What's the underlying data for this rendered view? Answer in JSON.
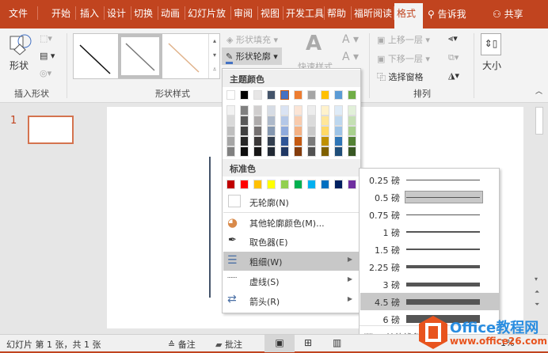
{
  "tabs": [
    "文件",
    "开始",
    "插入",
    "设计",
    "切换",
    "动画",
    "幻灯片放",
    "审阅",
    "视图",
    "开发工具",
    "帮助",
    "福昕阅读",
    "格式"
  ],
  "tell_me": "告诉我",
  "share": "共享",
  "ribbon": {
    "shapes_label": "形状",
    "insert_shapes_group": "插入形状",
    "shape_styles_group": "形状样式",
    "shape_fill": "形状填充",
    "shape_outline": "形状轮廓",
    "quick_styles": "快速样式",
    "bring_forward": "上移一层",
    "send_backward": "下移一层",
    "selection_pane": "选择窗格",
    "arrange_group": "排列",
    "size": "大小"
  },
  "menu": {
    "theme_colors": "主题颜色",
    "standard_colors": "标准色",
    "no_outline": "无轮廓(N)",
    "more_colors": "其他轮廓颜色(M)...",
    "eyedropper": "取色器(E)",
    "weight": "粗细(W)",
    "dashes": "虚线(S)",
    "arrows": "箭头(R)"
  },
  "theme_colors": [
    "#ffffff",
    "#000000",
    "#e7e6e6",
    "#44546a",
    "#4472c4",
    "#ed7d31",
    "#a5a5a5",
    "#ffc000",
    "#5b9bd5",
    "#70ad47"
  ],
  "theme_shades": [
    [
      "#f2f2f2",
      "#d9d9d9",
      "#bfbfbf",
      "#a6a6a6",
      "#808080"
    ],
    [
      "#808080",
      "#595959",
      "#404040",
      "#262626",
      "#0d0d0d"
    ],
    [
      "#d0cece",
      "#aeabab",
      "#757171",
      "#3b3838",
      "#171616"
    ],
    [
      "#d6dce5",
      "#adb9ca",
      "#8497b0",
      "#333f50",
      "#222a35"
    ],
    [
      "#dae3f3",
      "#b4c7e7",
      "#8faadc",
      "#2f5597",
      "#203864"
    ],
    [
      "#fbe5d6",
      "#f8cbad",
      "#f4b183",
      "#c55a11",
      "#843c0c"
    ],
    [
      "#ededed",
      "#dbdbdb",
      "#c9c9c9",
      "#7b7b7b",
      "#525252"
    ],
    [
      "#fff2cc",
      "#ffe699",
      "#ffd966",
      "#bf9000",
      "#7f6000"
    ],
    [
      "#deebf7",
      "#bdd7ee",
      "#9dc3e6",
      "#2e75b6",
      "#1f4e79"
    ],
    [
      "#e2f0d9",
      "#c5e0b4",
      "#a9d18e",
      "#548235",
      "#385723"
    ]
  ],
  "standard_colors": [
    "#c00000",
    "#ff0000",
    "#ffc000",
    "#ffff00",
    "#92d050",
    "#00b050",
    "#00b0f0",
    "#0070c0",
    "#002060",
    "#7030a0"
  ],
  "weights": [
    {
      "label": "0.25 磅",
      "pt": 0.25
    },
    {
      "label": "0.5 磅",
      "pt": 0.5,
      "current": true
    },
    {
      "label": "0.75 磅",
      "pt": 0.75
    },
    {
      "label": "1 磅",
      "pt": 1
    },
    {
      "label": "1.5 磅",
      "pt": 1.5
    },
    {
      "label": "2.25 磅",
      "pt": 2.25
    },
    {
      "label": "3 磅",
      "pt": 3
    },
    {
      "label": "4.5 磅",
      "pt": 4.5,
      "hover": true
    },
    {
      "label": "6 磅",
      "pt": 6
    }
  ],
  "more_lines": "其他线条",
  "slide_number": "1",
  "status": {
    "slide_info": "幻灯片 第 1 张，共 1 张",
    "notes": "备注",
    "comments": "批注",
    "zoom": "1%"
  },
  "watermark": {
    "brand": "Office教程网",
    "url": "www.office26.com"
  },
  "accent": "#c1441f"
}
